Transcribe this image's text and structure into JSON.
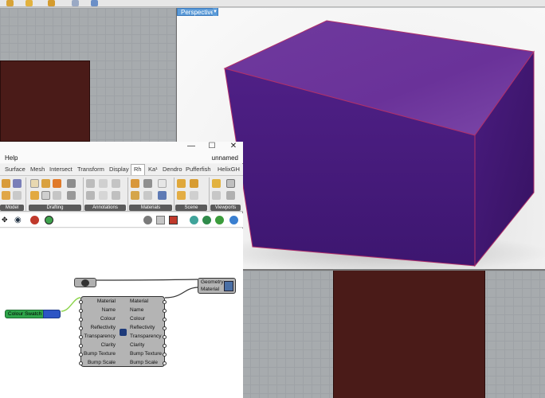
{
  "viewport": {
    "perspective_label": "Perspective",
    "dropdown_glyph": "▼"
  },
  "window": {
    "minimize": "—",
    "maximize": "☐",
    "close": "✕"
  },
  "menu": {
    "help": "Help",
    "document_name": "unnamed"
  },
  "tabs": [
    {
      "label": "Surface"
    },
    {
      "label": "Mesh"
    },
    {
      "label": "Intersect"
    },
    {
      "label": "Transform"
    },
    {
      "label": "Display"
    },
    {
      "label": "Rh",
      "active": true
    },
    {
      "label": "Ka¹"
    },
    {
      "label": "Dendro"
    },
    {
      "label": "Pufferfish"
    },
    {
      "label": "HelixGH"
    }
  ],
  "ribbon_groups": [
    {
      "label": "Model"
    },
    {
      "label": "Drafting"
    },
    {
      "label": "Annotations"
    },
    {
      "label": "Materials"
    },
    {
      "label": "Scene"
    },
    {
      "label": "Viewports"
    }
  ],
  "components": {
    "colour_swatch": {
      "label": "Colour Swatch"
    },
    "material": {
      "inputs": [
        "Material",
        "Name",
        "Colour",
        "Reflectivity",
        "Transparency",
        "Clarity",
        "Bump Texture",
        "Bump Scale"
      ],
      "outputs": [
        "Material",
        "Name",
        "Colour",
        "Reflectivity",
        "Transparency",
        "Clarity",
        "Bump Texture",
        "Bump Scale"
      ]
    },
    "custom_preview": {
      "inputs": [
        "Geometry",
        "Material"
      ]
    }
  },
  "colors": {
    "box_purple": "#5a2a8c",
    "dark_rect": "#4a1b18",
    "viewport_grid": "#a7abae",
    "swatch_green": "#2ea54a",
    "swatch_blue": "#2c55c4"
  }
}
